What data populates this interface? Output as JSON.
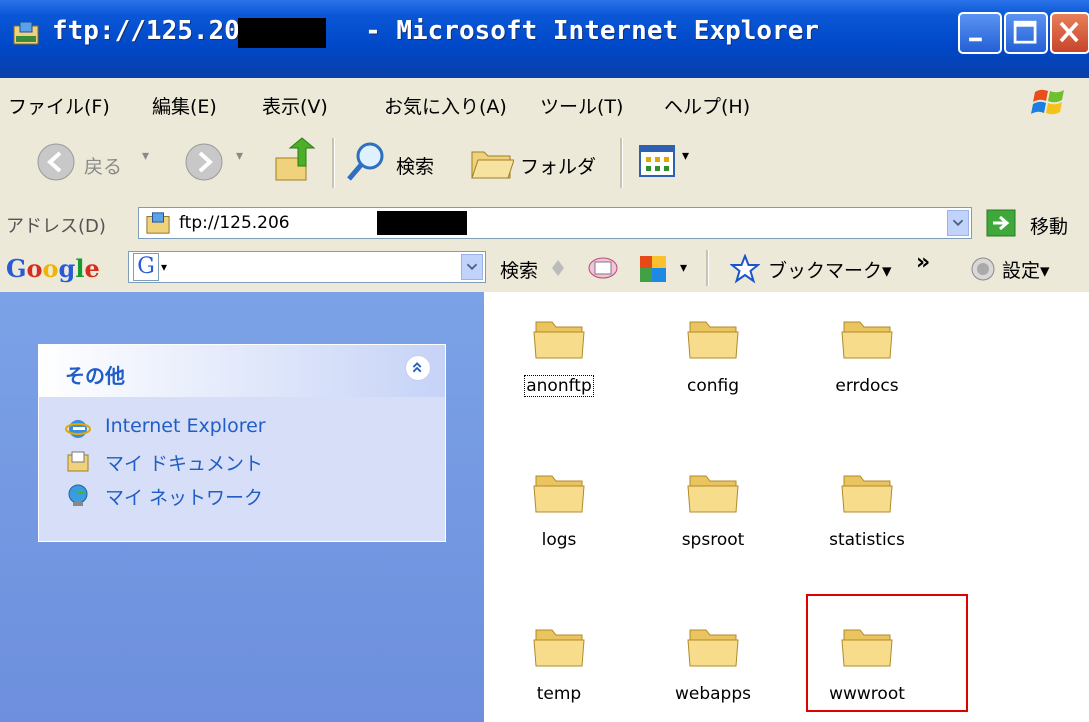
{
  "window": {
    "title": "ftp://125.206       - Microsoft Internet Explorer",
    "controls": {
      "minimize": "minimize",
      "maximize": "maximize",
      "close": "close"
    }
  },
  "menubar": {
    "items": [
      "ファイル(F)",
      "編集(E)",
      "表示(V)",
      "お気に入り(A)",
      "ツール(T)",
      "ヘルプ(H)"
    ]
  },
  "toolbar": {
    "back_label": "戻る",
    "search_label": "検索",
    "folders_label": "フォルダ"
  },
  "addressbar": {
    "label": "アドレス(D)",
    "value": "ftp://125.206",
    "go_label": "移動"
  },
  "googlebar": {
    "logo": "Google",
    "search_label": "検索",
    "bookmarks_label": "ブックマーク▾",
    "more_label": "»",
    "settings_label": "設定▾"
  },
  "taskpane": {
    "section_title": "その他",
    "links": [
      {
        "label": "Internet Explorer",
        "icon": "internet-explorer-icon"
      },
      {
        "label": "マイ ドキュメント",
        "icon": "my-documents-icon"
      },
      {
        "label": "マイ ネットワーク",
        "icon": "my-network-icon"
      }
    ]
  },
  "folders": [
    {
      "name": "anonftp",
      "focused": true
    },
    {
      "name": "config",
      "focused": false
    },
    {
      "name": "errdocs",
      "focused": false
    },
    {
      "name": "logs",
      "focused": false
    },
    {
      "name": "spsroot",
      "focused": false
    },
    {
      "name": "statistics",
      "focused": false
    },
    {
      "name": "temp",
      "focused": false
    },
    {
      "name": "webapps",
      "focused": false
    },
    {
      "name": "wwwroot",
      "focused": false,
      "highlighted": true
    }
  ],
  "colors": {
    "titlebar_blue": "#0048c8",
    "taskpane_blue": "#7ba2e7",
    "link_blue": "#215dc6",
    "highlight_red": "#e00000",
    "folder_yellow": "#f3d27a"
  }
}
